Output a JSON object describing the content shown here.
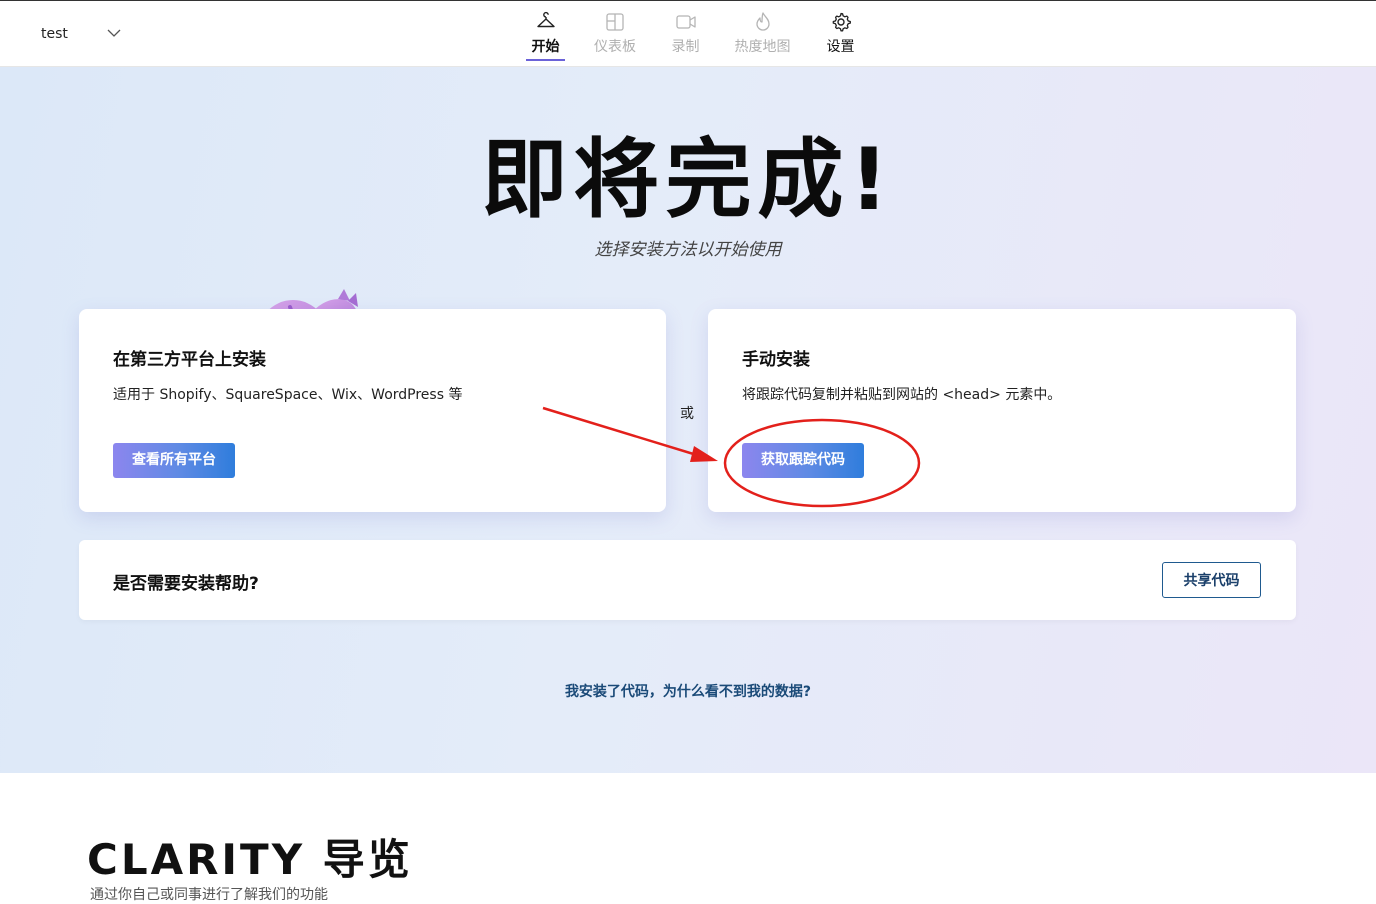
{
  "header": {
    "project_name": "test",
    "nav": [
      {
        "label": "开始",
        "icon": "hanger-icon",
        "state": "active"
      },
      {
        "label": "仪表板",
        "icon": "dashboard-icon",
        "state": "disabled"
      },
      {
        "label": "录制",
        "icon": "video-camera-icon",
        "state": "disabled"
      },
      {
        "label": "热度地图",
        "icon": "flame-icon",
        "state": "disabled"
      },
      {
        "label": "设置",
        "icon": "gear-icon",
        "state": "normal"
      }
    ]
  },
  "hero": {
    "title": "即将完成!",
    "subtitle": "选择安装方法以开始使用"
  },
  "third_party": {
    "title": "在第三方平台上安装",
    "description": "适用于 Shopify、SquareSpace、Wix、WordPress 等",
    "button": "查看所有平台"
  },
  "separator": "或",
  "manual": {
    "title": "手动安装",
    "description": "将跟踪代码复制并粘贴到网站的 <head> 元素中。",
    "button": "获取跟踪代码"
  },
  "help": {
    "title": "是否需要安装帮助?",
    "button": "共享代码"
  },
  "why_link": "我安装了代码，为什么看不到我的数据?",
  "tour": {
    "title": "CLARITY 导览",
    "subtitle": "通过你自己或同事进行了解我们的功能"
  },
  "colors": {
    "accent": "#6b62d8",
    "button_gradient_start": "#8c86ee",
    "button_gradient_end": "#2f7ddc",
    "link": "#1a4a78",
    "annotation_red": "#e3201b"
  }
}
